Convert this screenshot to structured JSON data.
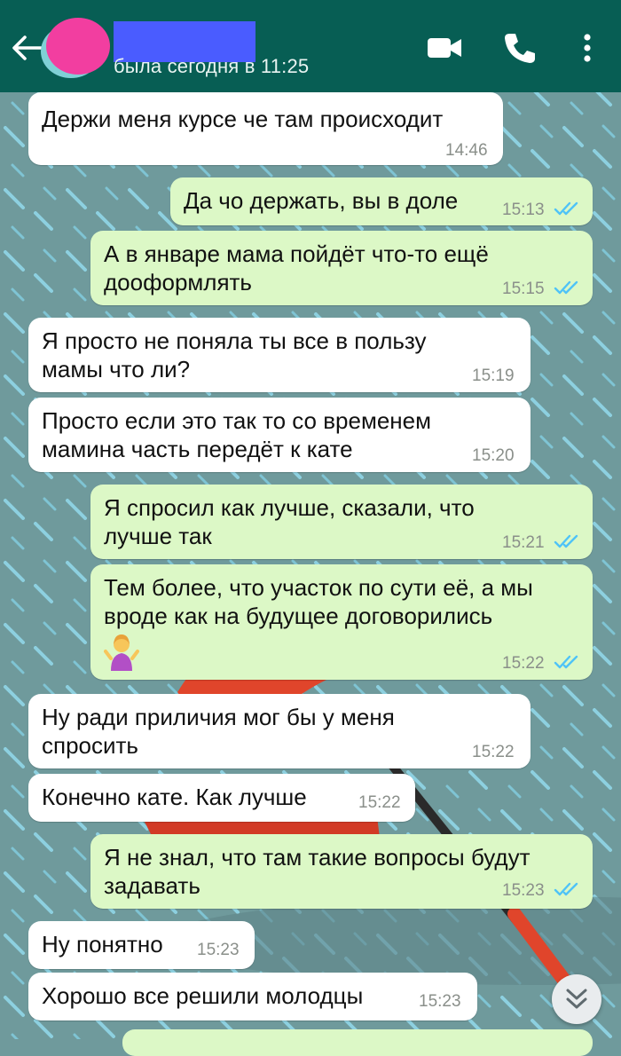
{
  "header": {
    "status": "была сегодня в 11:25"
  },
  "colors": {
    "header": "#075e54",
    "incoming": "#ffffff",
    "outgoing": "#dcf8c6",
    "read_ticks": "#4fc3f7",
    "avatar_redaction": "#f23ea0",
    "name_redaction": "#4a5cff"
  },
  "icons": {
    "back": "arrow-left-icon",
    "video": "video-call-icon",
    "call": "phone-icon",
    "menu": "more-vertical-icon",
    "scroll": "chevron-double-down-icon",
    "ticks": "double-check-icon"
  },
  "messages": [
    {
      "dir": "in",
      "text": "Держи меня курсе че там происходит",
      "time": "14:46"
    },
    {
      "dir": "out",
      "text": "Да чо держать, вы в доле",
      "time": "15:13",
      "read": true
    },
    {
      "dir": "out",
      "text": "А в январе мама пойдёт что-то ещё\nдооформлять",
      "time": "15:15",
      "read": true
    },
    {
      "dir": "in",
      "text": "Я просто не поняла ты все в пользу\nмамы что ли?",
      "time": "15:19"
    },
    {
      "dir": "in",
      "text": "Просто если это так то со временем\nмамина часть передёт к кате",
      "time": "15:20"
    },
    {
      "dir": "out",
      "text": "Я спросил как лучше, сказали, что\nлучше так",
      "time": "15:21",
      "read": true
    },
    {
      "dir": "out",
      "text": "Тем более, что участок по сути её, а мы\nвроде как на будущее договорились",
      "time": "15:22",
      "read": true,
      "emoji": "person-shrugging-emoji"
    },
    {
      "dir": "in",
      "text": "Ну ради приличия мог бы у меня\nспросить",
      "time": "15:22"
    },
    {
      "dir": "in",
      "text": "Конечно кате. Как лучше",
      "time": "15:22"
    },
    {
      "dir": "out",
      "text": "Я не знал, что там такие вопросы будут\nзадавать",
      "time": "15:23",
      "read": true
    },
    {
      "dir": "in",
      "text": "Ну понятно",
      "time": "15:23"
    },
    {
      "dir": "in",
      "text": "Хорошо все решили молодцы",
      "time": "15:23"
    }
  ]
}
